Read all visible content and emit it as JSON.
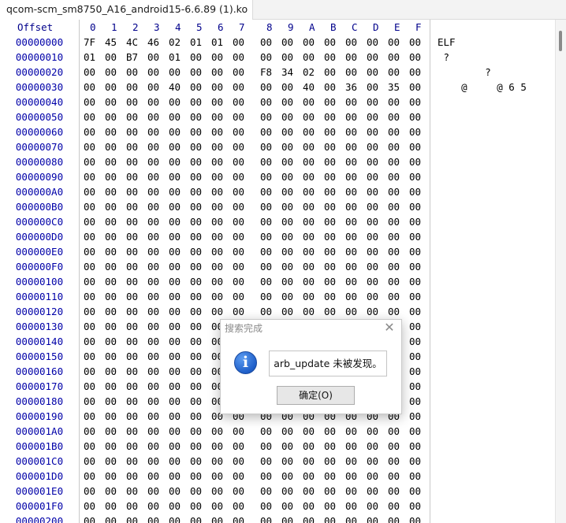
{
  "tab": {
    "title": "qcom-scm_sm8750_A16_android15-6.6.89 (1).ko"
  },
  "header": {
    "offset_label": "Offset",
    "columns": [
      "0",
      "1",
      "2",
      "3",
      "4",
      "5",
      "6",
      "7",
      "8",
      "9",
      "A",
      "B",
      "C",
      "D",
      "E",
      "F"
    ]
  },
  "rows": [
    {
      "offset": "00000000",
      "bytes": [
        "7F",
        "45",
        "4C",
        "46",
        "02",
        "01",
        "01",
        "00",
        "00",
        "00",
        "00",
        "00",
        "00",
        "00",
        "00",
        "00"
      ],
      "ascii": "ELF"
    },
    {
      "offset": "00000010",
      "bytes": [
        "01",
        "00",
        "B7",
        "00",
        "01",
        "00",
        "00",
        "00",
        "00",
        "00",
        "00",
        "00",
        "00",
        "00",
        "00",
        "00"
      ],
      "ascii": " ?"
    },
    {
      "offset": "00000020",
      "bytes": [
        "00",
        "00",
        "00",
        "00",
        "00",
        "00",
        "00",
        "00",
        "F8",
        "34",
        "02",
        "00",
        "00",
        "00",
        "00",
        "00"
      ],
      "ascii": "        ?"
    },
    {
      "offset": "00000030",
      "bytes": [
        "00",
        "00",
        "00",
        "00",
        "40",
        "00",
        "00",
        "00",
        "00",
        "00",
        "40",
        "00",
        "36",
        "00",
        "35",
        "00"
      ],
      "ascii": "    @     @ 6 5"
    },
    {
      "offset": "00000040",
      "bytes": [
        "00",
        "00",
        "00",
        "00",
        "00",
        "00",
        "00",
        "00",
        "00",
        "00",
        "00",
        "00",
        "00",
        "00",
        "00",
        "00"
      ],
      "ascii": ""
    },
    {
      "offset": "00000050",
      "bytes": [
        "00",
        "00",
        "00",
        "00",
        "00",
        "00",
        "00",
        "00",
        "00",
        "00",
        "00",
        "00",
        "00",
        "00",
        "00",
        "00"
      ],
      "ascii": ""
    },
    {
      "offset": "00000060",
      "bytes": [
        "00",
        "00",
        "00",
        "00",
        "00",
        "00",
        "00",
        "00",
        "00",
        "00",
        "00",
        "00",
        "00",
        "00",
        "00",
        "00"
      ],
      "ascii": ""
    },
    {
      "offset": "00000070",
      "bytes": [
        "00",
        "00",
        "00",
        "00",
        "00",
        "00",
        "00",
        "00",
        "00",
        "00",
        "00",
        "00",
        "00",
        "00",
        "00",
        "00"
      ],
      "ascii": ""
    },
    {
      "offset": "00000080",
      "bytes": [
        "00",
        "00",
        "00",
        "00",
        "00",
        "00",
        "00",
        "00",
        "00",
        "00",
        "00",
        "00",
        "00",
        "00",
        "00",
        "00"
      ],
      "ascii": ""
    },
    {
      "offset": "00000090",
      "bytes": [
        "00",
        "00",
        "00",
        "00",
        "00",
        "00",
        "00",
        "00",
        "00",
        "00",
        "00",
        "00",
        "00",
        "00",
        "00",
        "00"
      ],
      "ascii": ""
    },
    {
      "offset": "000000A0",
      "bytes": [
        "00",
        "00",
        "00",
        "00",
        "00",
        "00",
        "00",
        "00",
        "00",
        "00",
        "00",
        "00",
        "00",
        "00",
        "00",
        "00"
      ],
      "ascii": ""
    },
    {
      "offset": "000000B0",
      "bytes": [
        "00",
        "00",
        "00",
        "00",
        "00",
        "00",
        "00",
        "00",
        "00",
        "00",
        "00",
        "00",
        "00",
        "00",
        "00",
        "00"
      ],
      "ascii": ""
    },
    {
      "offset": "000000C0",
      "bytes": [
        "00",
        "00",
        "00",
        "00",
        "00",
        "00",
        "00",
        "00",
        "00",
        "00",
        "00",
        "00",
        "00",
        "00",
        "00",
        "00"
      ],
      "ascii": ""
    },
    {
      "offset": "000000D0",
      "bytes": [
        "00",
        "00",
        "00",
        "00",
        "00",
        "00",
        "00",
        "00",
        "00",
        "00",
        "00",
        "00",
        "00",
        "00",
        "00",
        "00"
      ],
      "ascii": ""
    },
    {
      "offset": "000000E0",
      "bytes": [
        "00",
        "00",
        "00",
        "00",
        "00",
        "00",
        "00",
        "00",
        "00",
        "00",
        "00",
        "00",
        "00",
        "00",
        "00",
        "00"
      ],
      "ascii": ""
    },
    {
      "offset": "000000F0",
      "bytes": [
        "00",
        "00",
        "00",
        "00",
        "00",
        "00",
        "00",
        "00",
        "00",
        "00",
        "00",
        "00",
        "00",
        "00",
        "00",
        "00"
      ],
      "ascii": ""
    },
    {
      "offset": "00000100",
      "bytes": [
        "00",
        "00",
        "00",
        "00",
        "00",
        "00",
        "00",
        "00",
        "00",
        "00",
        "00",
        "00",
        "00",
        "00",
        "00",
        "00"
      ],
      "ascii": ""
    },
    {
      "offset": "00000110",
      "bytes": [
        "00",
        "00",
        "00",
        "00",
        "00",
        "00",
        "00",
        "00",
        "00",
        "00",
        "00",
        "00",
        "00",
        "00",
        "00",
        "00"
      ],
      "ascii": ""
    },
    {
      "offset": "00000120",
      "bytes": [
        "00",
        "00",
        "00",
        "00",
        "00",
        "00",
        "00",
        "00",
        "00",
        "00",
        "00",
        "00",
        "00",
        "00",
        "00",
        "00"
      ],
      "ascii": ""
    },
    {
      "offset": "00000130",
      "bytes": [
        "00",
        "00",
        "00",
        "00",
        "00",
        "00",
        "00",
        "00",
        "00",
        "00",
        "00",
        "00",
        "00",
        "00",
        "00",
        "00"
      ],
      "ascii": ""
    },
    {
      "offset": "00000140",
      "bytes": [
        "00",
        "00",
        "00",
        "00",
        "00",
        "00",
        "00",
        "00",
        "00",
        "00",
        "00",
        "00",
        "00",
        "00",
        "00",
        "00"
      ],
      "ascii": ""
    },
    {
      "offset": "00000150",
      "bytes": [
        "00",
        "00",
        "00",
        "00",
        "00",
        "00",
        "00",
        "00",
        "00",
        "00",
        "00",
        "00",
        "00",
        "00",
        "00",
        "00"
      ],
      "ascii": ""
    },
    {
      "offset": "00000160",
      "bytes": [
        "00",
        "00",
        "00",
        "00",
        "00",
        "00",
        "00",
        "00",
        "00",
        "00",
        "00",
        "00",
        "00",
        "00",
        "00",
        "00"
      ],
      "ascii": ""
    },
    {
      "offset": "00000170",
      "bytes": [
        "00",
        "00",
        "00",
        "00",
        "00",
        "00",
        "00",
        "00",
        "00",
        "00",
        "00",
        "00",
        "00",
        "00",
        "00",
        "00"
      ],
      "ascii": ""
    },
    {
      "offset": "00000180",
      "bytes": [
        "00",
        "00",
        "00",
        "00",
        "00",
        "00",
        "00",
        "00",
        "00",
        "00",
        "00",
        "00",
        "00",
        "00",
        "00",
        "00"
      ],
      "ascii": ""
    },
    {
      "offset": "00000190",
      "bytes": [
        "00",
        "00",
        "00",
        "00",
        "00",
        "00",
        "00",
        "00",
        "00",
        "00",
        "00",
        "00",
        "00",
        "00",
        "00",
        "00"
      ],
      "ascii": ""
    },
    {
      "offset": "000001A0",
      "bytes": [
        "00",
        "00",
        "00",
        "00",
        "00",
        "00",
        "00",
        "00",
        "00",
        "00",
        "00",
        "00",
        "00",
        "00",
        "00",
        "00"
      ],
      "ascii": ""
    },
    {
      "offset": "000001B0",
      "bytes": [
        "00",
        "00",
        "00",
        "00",
        "00",
        "00",
        "00",
        "00",
        "00",
        "00",
        "00",
        "00",
        "00",
        "00",
        "00",
        "00"
      ],
      "ascii": ""
    },
    {
      "offset": "000001C0",
      "bytes": [
        "00",
        "00",
        "00",
        "00",
        "00",
        "00",
        "00",
        "00",
        "00",
        "00",
        "00",
        "00",
        "00",
        "00",
        "00",
        "00"
      ],
      "ascii": ""
    },
    {
      "offset": "000001D0",
      "bytes": [
        "00",
        "00",
        "00",
        "00",
        "00",
        "00",
        "00",
        "00",
        "00",
        "00",
        "00",
        "00",
        "00",
        "00",
        "00",
        "00"
      ],
      "ascii": ""
    },
    {
      "offset": "000001E0",
      "bytes": [
        "00",
        "00",
        "00",
        "00",
        "00",
        "00",
        "00",
        "00",
        "00",
        "00",
        "00",
        "00",
        "00",
        "00",
        "00",
        "00"
      ],
      "ascii": ""
    },
    {
      "offset": "000001F0",
      "bytes": [
        "00",
        "00",
        "00",
        "00",
        "00",
        "00",
        "00",
        "00",
        "00",
        "00",
        "00",
        "00",
        "00",
        "00",
        "00",
        "00"
      ],
      "ascii": ""
    },
    {
      "offset": "00000200",
      "bytes": [
        "00",
        "00",
        "00",
        "00",
        "00",
        "00",
        "00",
        "00",
        "00",
        "00",
        "00",
        "00",
        "00",
        "00",
        "00",
        "00"
      ],
      "ascii": ""
    }
  ],
  "dialog": {
    "title": "搜索完成",
    "close_glyph": "✕",
    "icon": "info-icon",
    "icon_glyph": "i",
    "message": "arb_update 未被发现。",
    "ok_label": "确定(O)"
  }
}
